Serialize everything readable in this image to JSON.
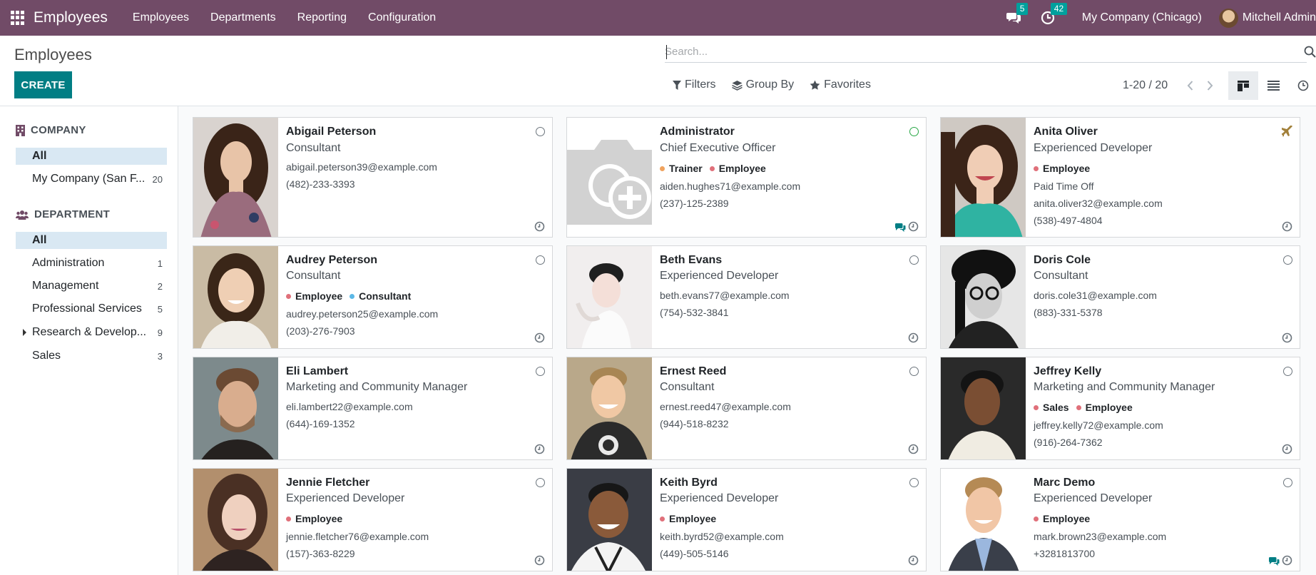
{
  "navbar": {
    "app_title": "Employees",
    "menus": [
      "Employees",
      "Departments",
      "Reporting",
      "Configuration"
    ],
    "messages_count": "5",
    "activities_count": "42",
    "company": "My Company (Chicago)",
    "user": "Mitchell Admin"
  },
  "control_panel": {
    "breadcrumb": "Employees",
    "create_label": "CREATE",
    "search_placeholder": "Search...",
    "filters_label": "Filters",
    "groupby_label": "Group By",
    "favorites_label": "Favorites",
    "pager": "1-20 / 20"
  },
  "sidebar": {
    "company_title": "COMPANY",
    "company_items": [
      {
        "label": "All",
        "count": ""
      },
      {
        "label": "My Company (San F...",
        "count": "20"
      }
    ],
    "department_title": "DEPARTMENT",
    "department_items": [
      {
        "label": "All",
        "count": ""
      },
      {
        "label": "Administration",
        "count": "1"
      },
      {
        "label": "Management",
        "count": "2"
      },
      {
        "label": "Professional Services",
        "count": "5"
      },
      {
        "label": "Research & Develop...",
        "count": "9"
      },
      {
        "label": "Sales",
        "count": "3"
      }
    ]
  },
  "tag_colors": {
    "Employee": "#e0707a",
    "Consultant": "#5cb8e6",
    "Trainer": "#f0a35e",
    "Sales": "#e0707a"
  },
  "employees": [
    {
      "name": "Abigail Peterson",
      "job": "Consultant",
      "tags": [],
      "note": "",
      "email": "abigail.peterson39@example.com",
      "phone": "(482)-233-3393"
    },
    {
      "name": "Administrator",
      "job": "Chief Executive Officer",
      "tags": [
        "Trainer",
        "Employee"
      ],
      "note": "",
      "email": "aiden.hughes71@example.com",
      "phone": "(237)-125-2389"
    },
    {
      "name": "Anita Oliver",
      "job": "Experienced Developer",
      "tags": [
        "Employee"
      ],
      "note": "Paid Time Off",
      "email": "anita.oliver32@example.com",
      "phone": "(538)-497-4804"
    },
    {
      "name": "Audrey Peterson",
      "job": "Consultant",
      "tags": [
        "Employee",
        "Consultant"
      ],
      "note": "",
      "email": "audrey.peterson25@example.com",
      "phone": "(203)-276-7903"
    },
    {
      "name": "Beth Evans",
      "job": "Experienced Developer",
      "tags": [],
      "note": "",
      "email": "beth.evans77@example.com",
      "phone": "(754)-532-3841"
    },
    {
      "name": "Doris Cole",
      "job": "Consultant",
      "tags": [],
      "note": "",
      "email": "doris.cole31@example.com",
      "phone": "(883)-331-5378"
    },
    {
      "name": "Eli Lambert",
      "job": "Marketing and Community Manager",
      "tags": [],
      "note": "",
      "email": "eli.lambert22@example.com",
      "phone": "(644)-169-1352"
    },
    {
      "name": "Ernest Reed",
      "job": "Consultant",
      "tags": [],
      "note": "",
      "email": "ernest.reed47@example.com",
      "phone": "(944)-518-8232"
    },
    {
      "name": "Jeffrey Kelly",
      "job": "Marketing and Community Manager",
      "tags": [
        "Sales",
        "Employee"
      ],
      "note": "",
      "email": "jeffrey.kelly72@example.com",
      "phone": "(916)-264-7362"
    },
    {
      "name": "Jennie Fletcher",
      "job": "Experienced Developer",
      "tags": [
        "Employee"
      ],
      "note": "",
      "email": "jennie.fletcher76@example.com",
      "phone": "(157)-363-8229"
    },
    {
      "name": "Keith Byrd",
      "job": "Experienced Developer",
      "tags": [
        "Employee"
      ],
      "note": "",
      "email": "keith.byrd52@example.com",
      "phone": "(449)-505-5146"
    },
    {
      "name": "Marc Demo",
      "job": "Experienced Developer",
      "tags": [
        "Employee"
      ],
      "note": "",
      "email": "mark.brown23@example.com",
      "phone": "+3281813700"
    }
  ]
}
